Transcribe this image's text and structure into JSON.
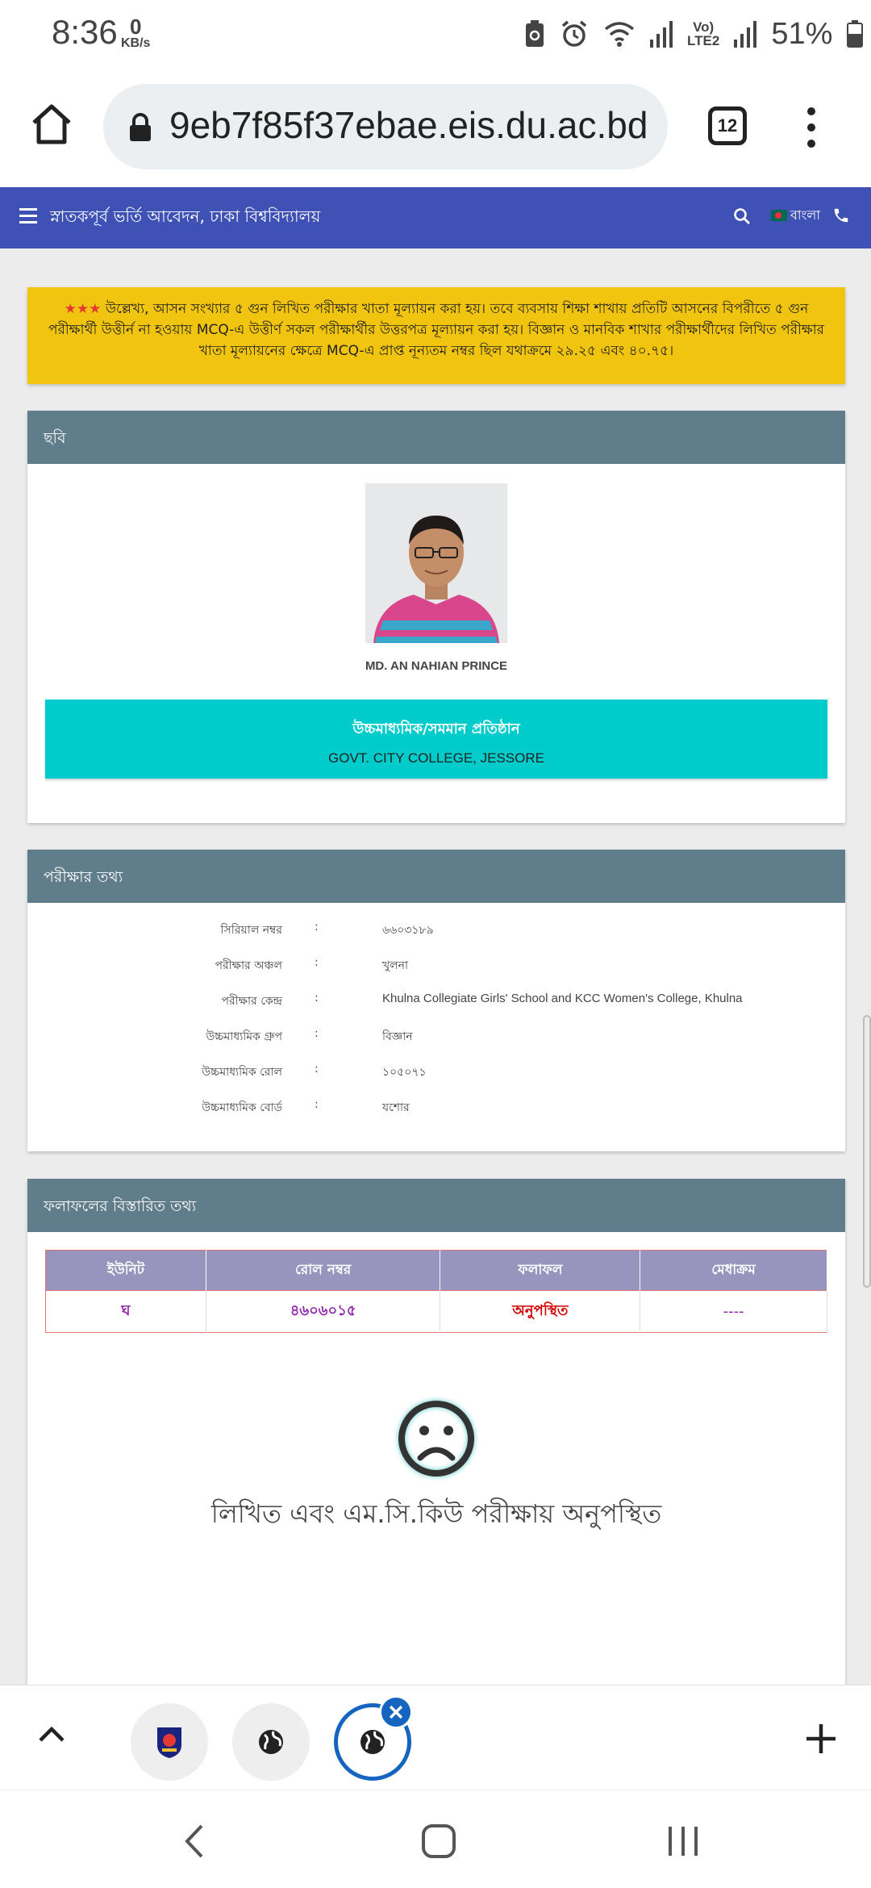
{
  "status_bar": {
    "time": "8:36",
    "net_speed_value": "0",
    "net_speed_unit": "KB/s",
    "lte_label_top": "Vo)",
    "lte_label_bottom": "LTE2",
    "battery_percent": "51%"
  },
  "browser": {
    "url": "9eb7f85f37ebae.eis.du.ac.bd",
    "tab_count": "12"
  },
  "site_header": {
    "title": "স্নাতকপূর্ব ভর্তি আবেদন, ঢাকা বিশ্ববিদ্যালয়",
    "language": "বাংলা"
  },
  "notice": {
    "stars": "★★★",
    "text": "উল্লেখ্য, আসন সংখ্যার ৫ গুন লিখিত পরীক্ষার খাতা মূল্যায়ন করা হয়। তবে ব্যবসায় শিক্ষা শাখায় প্রতিটি আসনের বিপরীতে ৫ গুন পরীক্ষার্থী উত্তীর্ন না হওয়ায় MCQ-এ উত্তীর্ণ সকল পরীক্ষার্থীর উত্তরপত্র মূল্যায়ন করা হয়। বিজ্ঞান ও মানবিক শাখার পরীক্ষার্থীদের লিখিত পরীক্ষার খাতা মূল্যায়নের ক্ষেত্রে MCQ-এ প্রাপ্ত নূন্যতম নম্বর ছিল যথাক্রমে ২৯.২৫ এবং ৪০.৭৫।"
  },
  "photo_card": {
    "heading": "ছবি",
    "student_name": "MD. AN NAHIAN PRINCE",
    "institution_label": "উচ্চমাধ্যমিক/সমমান প্রতিষ্ঠান",
    "institution_name": "GOVT. CITY COLLEGE, JESSORE"
  },
  "exam_info": {
    "heading": "পরীক্ষার তথ্য",
    "colon": ":",
    "rows": [
      {
        "label": "সিরিয়াল নম্বর",
        "value": "৬৬০৩১৮৯"
      },
      {
        "label": "পরীক্ষার অঞ্চল",
        "value": "খুলনা"
      },
      {
        "label": "পরীক্ষার কেন্দ্র",
        "value": "Khulna Collegiate Girls' School and KCC Women's College, Khulna"
      },
      {
        "label": "উচ্চমাধ্যমিক গ্রুপ",
        "value": "বিজ্ঞান"
      },
      {
        "label": "উচ্চমাধ্যমিক রোল",
        "value": "১০৫০৭১"
      },
      {
        "label": "উচ্চমাধ্যমিক বোর্ড",
        "value": "যশোর"
      }
    ]
  },
  "result": {
    "heading": "ফলাফলের বিস্তারিত তথ্য",
    "columns": [
      "ইউনিট",
      "রোল নম্বর",
      "ফলাফল",
      "মেধাক্রম"
    ],
    "row": {
      "unit": "ঘ",
      "roll": "৪৬০৬০১৫",
      "status": "অনুপস্থিত",
      "merit": "----"
    },
    "absent_message": "লিখিত এবং এম.সি.কিউ পরীক্ষায় অনুপস্থিত"
  },
  "colors": {
    "header_blue": "#3f51b5",
    "notice_yellow": "#f1c40f",
    "card_head": "#607d8b",
    "institution_cyan": "#00cccc",
    "table_head": "#9795bd",
    "absent_red": "#d50000",
    "tab_active_blue": "#1565c0"
  },
  "icons": [
    "home-icon",
    "lock-icon",
    "tabs-icon",
    "more-icon",
    "menu-icon",
    "search-icon",
    "flag-icon",
    "phone-icon",
    "sad-face-icon",
    "chevron-up-icon",
    "globe-icon",
    "close-icon",
    "plus-icon",
    "back-icon",
    "home-nav-icon",
    "recent-apps-icon"
  ]
}
